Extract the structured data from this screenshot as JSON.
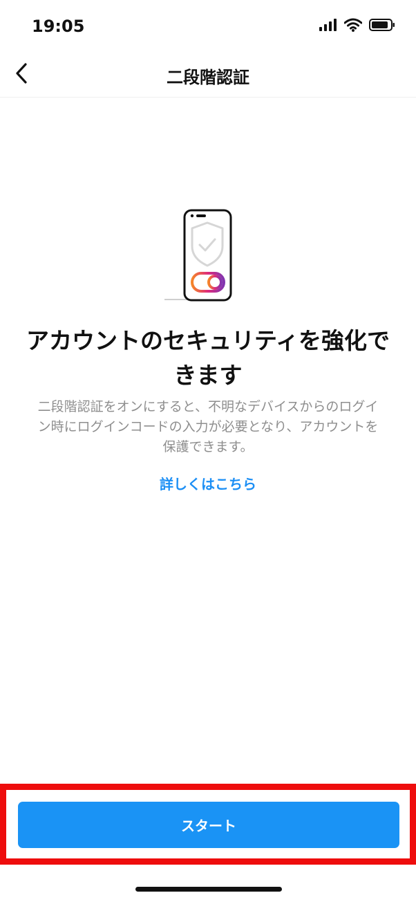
{
  "status_bar": {
    "time": "19:05",
    "icons": [
      "cellular-signal-icon",
      "wifi-icon",
      "battery-icon"
    ]
  },
  "nav": {
    "back_icon": "chevron-left-icon",
    "title": "二段階認証"
  },
  "illustration": {
    "icon": "phone-shield-toggle-icon",
    "colors": {
      "gradient_start": "#f58529",
      "gradient_mid": "#dd2a7b",
      "gradient_end": "#8134af"
    }
  },
  "content": {
    "headline": "アカウントのセキュリティを強化できます",
    "description": "二段階認証をオンにすると、不明なデバイスからのログイン時にログインコードの入力が必要となり、アカウントを保護できます。",
    "learn_more": "詳しくはこちら"
  },
  "footer": {
    "start_button": "スタート",
    "colors": {
      "button": "#1a93f5",
      "highlight": "#ee0d0d"
    }
  }
}
